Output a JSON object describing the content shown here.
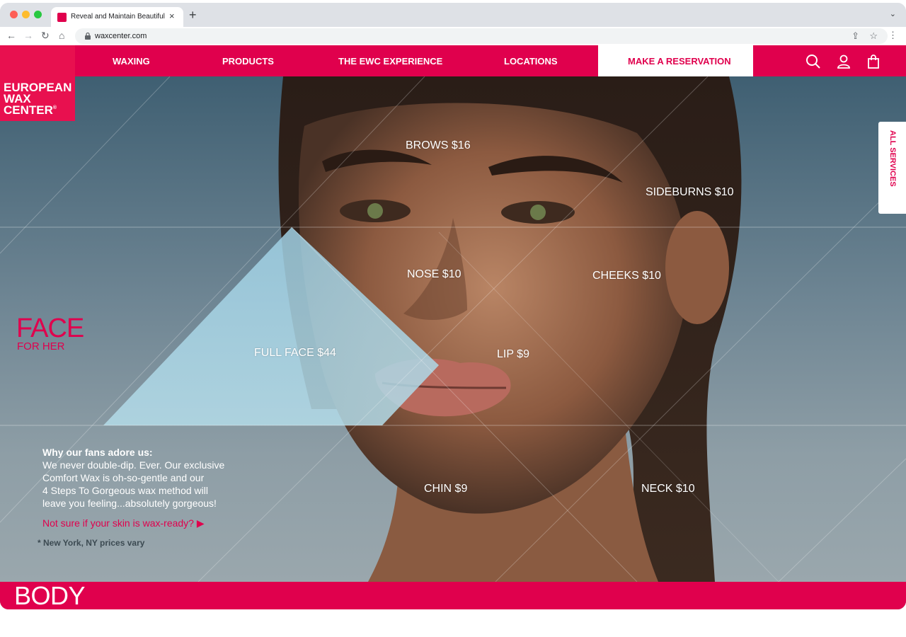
{
  "browser": {
    "tab_title": "Reveal and Maintain Beautiful Skin",
    "new_tab_icon": "+",
    "tab_close_icon": "×",
    "url": "waxcenter.com"
  },
  "brand": {
    "logo_lines": [
      "EUROPEAN",
      "WAX",
      "CENTER"
    ],
    "logo_reg": "®",
    "accent_color": "#e0004d"
  },
  "nav": {
    "items": [
      "WAXING",
      "PRODUCTS",
      "THE EWC EXPERIENCE",
      "LOCATIONS"
    ],
    "reserve_label": "MAKE A RESERVATION",
    "icons": [
      "search-icon",
      "account-icon",
      "bag-icon"
    ]
  },
  "side_tab": {
    "label": "ALL SERVICES"
  },
  "section": {
    "title": "FACE",
    "subtitle": "FOR HER"
  },
  "prices": {
    "brows": "BROWS $16",
    "sideburns": "SIDEBURNS $10",
    "nose": "NOSE $10",
    "cheeks": "CHEEKS $10",
    "full_face": "FULL FACE $44",
    "lip": "LIP $9",
    "chin": "CHIN $9",
    "neck": "NECK $10"
  },
  "copy": {
    "heading": "Why our fans adore us:",
    "lines": [
      "We never double-dip. Ever. Our exclusive",
      "Comfort Wax is oh-so-gentle and our",
      "4 Steps To Gorgeous wax method will",
      "leave you feeling...absolutely gorgeous!"
    ],
    "link": "Not sure if your skin is wax-ready? ▶",
    "note": "* New York, NY prices vary"
  },
  "next_section": {
    "title": "BODY"
  }
}
